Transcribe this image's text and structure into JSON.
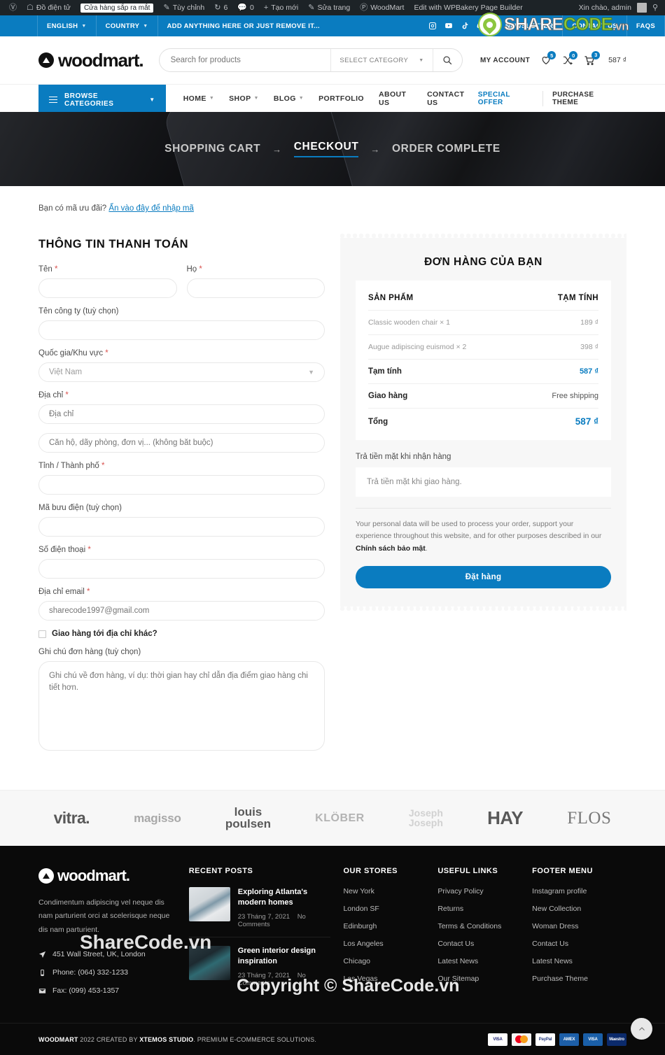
{
  "admin_bar": {
    "items": [
      {
        "icon": "wordpress-icon",
        "label": ""
      },
      {
        "icon": "shop-icon",
        "label": "Đồ điện tử"
      },
      {
        "icon": "",
        "label": "Cửa hàng sắp ra mắt",
        "pill": true
      },
      {
        "icon": "pencil-icon",
        "label": "Tùy chỉnh"
      },
      {
        "icon": "refresh-icon",
        "label": "6"
      },
      {
        "icon": "comment-icon",
        "label": "0"
      },
      {
        "icon": "plus-icon",
        "label": "Tạo mới"
      },
      {
        "icon": "edit-icon",
        "label": "Sửa trang"
      },
      {
        "icon": "woodmart-icon",
        "label": "WoodMart"
      },
      {
        "icon": "",
        "label": "Edit with WPBakery Page Builder"
      }
    ],
    "greeting": "Xin chào, admin",
    "search_icon": "search-icon"
  },
  "topbar": {
    "language": "ENGLISH",
    "country": "COUNTRY",
    "promo": "ADD ANYTHING HERE OR JUST REMOVE IT...",
    "social": [
      "instagram-icon",
      "youtube-icon",
      "tiktok-icon",
      "discord-icon"
    ],
    "links": [
      "NEWSLETTER",
      "CONTACT US",
      "FAQS"
    ]
  },
  "header": {
    "brand": "woodmart.",
    "search_placeholder": "Search for products",
    "search_category": "SELECT CATEGORY",
    "my_account": "MY ACCOUNT",
    "wishlist_count": "5",
    "compare_count": "0",
    "cart_count": "3",
    "cart_total": "587 ₫"
  },
  "nav": {
    "browse_categories": "BROWSE CATEGORIES",
    "menu": [
      {
        "label": "HOME",
        "caret": true
      },
      {
        "label": "SHOP",
        "caret": true
      },
      {
        "label": "BLOG",
        "caret": true
      },
      {
        "label": "PORTFOLIO",
        "caret": false
      },
      {
        "label": "ABOUT US",
        "caret": false
      },
      {
        "label": "CONTACT US",
        "caret": false
      }
    ],
    "special_offer": "SPECIAL OFFER",
    "purchase_theme": "PURCHASE THEME"
  },
  "hero": {
    "step1": "SHOPPING CART",
    "step2": "CHECKOUT",
    "step3": "ORDER COMPLETE",
    "arrow": "→"
  },
  "checkout": {
    "coupon_text": "Bạn có mã ưu đãi?",
    "coupon_link": "Ẩn vào đây để nhập mã",
    "billing_title": "THÔNG TIN THANH TOÁN",
    "first_name_label": "Tên",
    "last_name_label": "Họ",
    "company_label": "Tên công ty (tuỳ chọn)",
    "country_label": "Quốc gia/Khu vực",
    "country_value": "Việt Nam",
    "address_label": "Địa chỉ",
    "address_placeholder": "Địa chỉ",
    "address2_placeholder": "Căn hộ, dãy phòng, đơn vị... (không bắt buộc)",
    "city_label": "Tỉnh / Thành phố",
    "postcode_label": "Mã bưu điện (tuỳ chọn)",
    "phone_label": "Số điện thoại",
    "email_label": "Địa chỉ email",
    "email_value": "sharecode1997@gmail.com",
    "ship_different_label": "Giao hàng tới địa chỉ khác?",
    "notes_label": "Ghi chú đơn hàng (tuỳ chọn)",
    "notes_placeholder": "Ghi chú về đơn hàng, ví dụ: thời gian hay chỉ dẫn địa điểm giao hàng chi tiết hơn.",
    "required_mark": "*"
  },
  "order": {
    "title": "ĐƠN HÀNG CỦA BẠN",
    "col_product": "SẢN PHẨM",
    "col_subtotal": "TẠM TÍNH",
    "items": [
      {
        "name": "Classic wooden chair  × 1",
        "price": "189 ₫"
      },
      {
        "name": "Augue adipiscing euismod  × 2",
        "price": "398 ₫"
      }
    ],
    "subtotal_label": "Tạm tính",
    "subtotal_value": "587 ₫",
    "shipping_label": "Giao hàng",
    "shipping_value": "Free shipping",
    "total_label": "Tổng",
    "total_value": "587 ₫",
    "payment_method": "Trả tiền mặt khi nhận hàng",
    "payment_desc": "Trả tiền mặt khi giao hàng.",
    "privacy_text_1": "Your personal data will be used to process your order, support your experience throughout this website, and for other purposes described in our ",
    "privacy_link": "Chính sách bảo mật",
    "privacy_text_2": ".",
    "place_order": "Đặt hàng"
  },
  "brands": [
    {
      "name": "vitra.",
      "id": "brand-vitra"
    },
    {
      "name": "magisso",
      "id": "brand-magisso"
    },
    {
      "name_1": "louis",
      "name_2": "poulsen",
      "id": "brand-louis-poulsen"
    },
    {
      "name": "KLÖBER",
      "id": "brand-klober"
    },
    {
      "name_1": "Joseph",
      "name_2": "Joseph",
      "id": "brand-joseph-joseph"
    },
    {
      "name": "HAY",
      "id": "brand-hay"
    },
    {
      "name": "FLOS",
      "id": "brand-flos"
    }
  ],
  "footer": {
    "brand": "woodmart.",
    "description": "Condimentum adipiscing vel neque dis nam parturient orci at scelerisque neque dis nam parturient.",
    "address": "451 Wall Street, UK, London",
    "phone": "Phone: (064) 332-1233",
    "fax": "Fax: (099) 453-1357",
    "recent_posts_title": "RECENT POSTS",
    "posts": [
      {
        "title": "Exploring Atlanta's modern homes",
        "date": "23 Tháng 7, 2021",
        "comments": "No Comments"
      },
      {
        "title": "Green interior design inspiration",
        "date": "23 Tháng 7, 2021",
        "comments": "No Comments"
      }
    ],
    "stores_title": "OUR STORES",
    "stores": [
      "New York",
      "London SF",
      "Edinburgh",
      "Los Angeles",
      "Chicago",
      "Las Vegas"
    ],
    "links_title": "USEFUL LINKS",
    "links": [
      "Privacy Policy",
      "Returns",
      "Terms & Conditions",
      "Contact Us",
      "Latest News",
      "Our Sitemap"
    ],
    "menu_title": "FOOTER MENU",
    "menu": [
      "Instagram profile",
      "New Collection",
      "Woman Dress",
      "Contact Us",
      "Latest News",
      "Purchase Theme"
    ],
    "copyright_brand": "WOODMART",
    "copyright_text": " 2022 CREATED BY ",
    "copyright_author": "XTEMOS STUDIO",
    "copyright_tail": ". PREMIUM E-COMMERCE SOLUTIONS.",
    "payments": [
      "VISA",
      "MasterCard",
      "PayPal",
      "AMERICAN EXPRESS",
      "VISA Electron",
      "Maestro"
    ],
    "scroll_top_icon": "chevron-up-icon"
  },
  "watermarks": {
    "logo_part1": "SHARE",
    "logo_part2": "CODE",
    "logo_part3": ".vn",
    "mid": "ShareCode.vn",
    "copyright": "Copyright © ShareCode.vn"
  },
  "colors": {
    "accent": "#0a7cc0",
    "admin_bar": "#1d2327",
    "footer_bg": "#0a0a0a",
    "panel_bg": "#f7f7f7"
  }
}
